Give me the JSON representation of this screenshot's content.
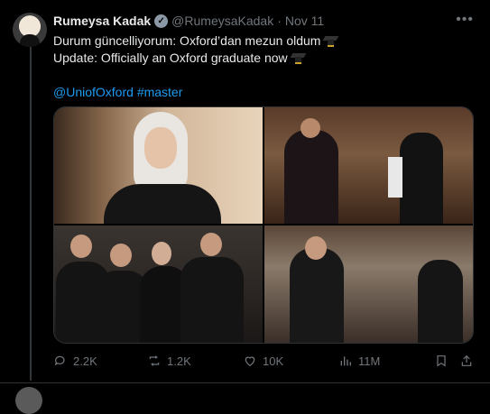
{
  "tweet": {
    "display_name": "Rumeysa Kadak",
    "handle": "@RumeysaKadak",
    "separator": "·",
    "date": "Nov 11",
    "line1": "Durum güncelliyorum: Oxford’dan mezun oldum",
    "line2": "Update: Officially an Oxford graduate now",
    "mention": "@UniofOxford",
    "hashtag": "#master"
  },
  "stats": {
    "replies": "2.2K",
    "reposts": "1.2K",
    "likes": "10K",
    "views": "11M"
  },
  "icons": [
    "verified-badge-icon",
    "more-icon",
    "graduation-cap-icon",
    "reply-icon",
    "repost-icon",
    "like-icon",
    "views-icon",
    "bookmark-icon",
    "share-icon"
  ],
  "colors": {
    "background": "#000000",
    "text": "#e7e9ea",
    "muted": "#71767b",
    "link": "#1d9bf0"
  }
}
